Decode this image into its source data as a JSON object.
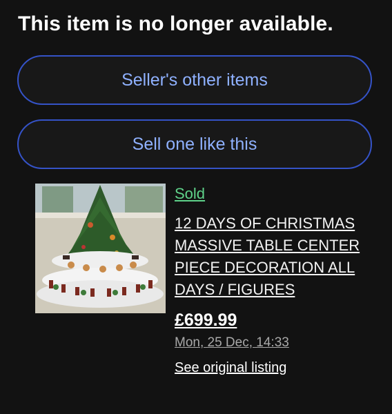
{
  "page": {
    "heading": "This item is no longer available."
  },
  "actions": {
    "sellers_other_items": "Seller's other items",
    "sell_one_like_this": "Sell one like this"
  },
  "listing": {
    "status": "Sold",
    "title": "12 DAYS OF CHRISTMAS MASSIVE TABLE CENTER PIECE DECORATION ALL DAYS / FIGURES",
    "price": "£699.99",
    "date": "Mon, 25 Dec, 14:33",
    "see_original": "See original listing",
    "image_icon": "christmas-centerpiece-photo"
  },
  "colors": {
    "background": "#121212",
    "accent_blue": "#3553c8",
    "button_text": "#8fb1ff",
    "sold_green": "#5fd38a"
  }
}
